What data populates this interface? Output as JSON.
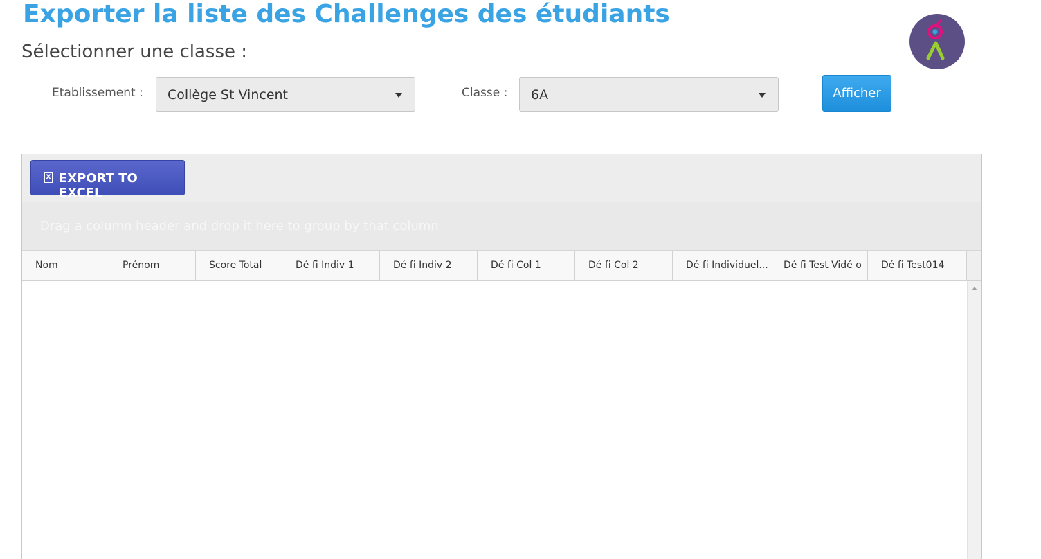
{
  "header": {
    "title": "Exporter la liste des Challenges des étudiants",
    "subtitle": "Sélectionner une classe :"
  },
  "filters": {
    "etablissement_label": "Etablissement :",
    "etablissement_value": "Collège St Vincent",
    "classe_label": "Classe :",
    "classe_value": "6A",
    "afficher_label": "Afficher"
  },
  "grid": {
    "export_icon": "excel-icon",
    "export_label": "EXPORT TO EXCEL",
    "group_hint": "Drag a column header and drop it here to group by that column",
    "columns": [
      "Nom",
      "Prénom",
      "Score Total",
      "Dé fi Indiv 1",
      "Dé fi Indiv 2",
      "Dé fi Col 1",
      "Dé fi Col 2",
      "Dé fi Individuel...",
      "Dé fi Test Vidé o",
      "Dé fi Test014"
    ]
  },
  "colors": {
    "title": "#3aa3e3",
    "afficher_button": "#2196e3",
    "export_button": "#3f51b5",
    "avatar_bg": "#5b4f85"
  }
}
